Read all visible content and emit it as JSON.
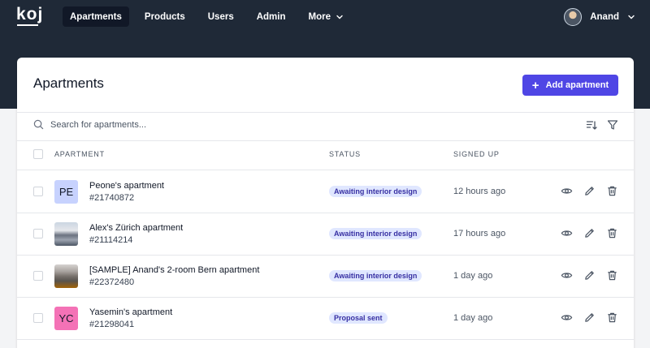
{
  "header": {
    "logo": "koj",
    "nav": [
      {
        "label": "Apartments"
      },
      {
        "label": "Products"
      },
      {
        "label": "Users"
      },
      {
        "label": "Admin"
      },
      {
        "label": "More"
      }
    ],
    "user_name": "Anand"
  },
  "page": {
    "title": "Apartments",
    "add_button": "Add apartment",
    "search_placeholder": "Search for apartments..."
  },
  "table": {
    "columns": [
      "APARTMENT",
      "STATUS",
      "SIGNED UP"
    ],
    "rows": [
      {
        "name": "Peone's apartment",
        "id": "#21740872",
        "status": "Awaiting interior design",
        "signed_up": "12 hours ago",
        "thumb_text": "PE",
        "thumb_color": "#c7d2fe"
      },
      {
        "name": "Alex's Zürich apartment",
        "id": "#21114214",
        "status": "Awaiting interior design",
        "signed_up": "17 hours ago",
        "thumb_text": "",
        "thumb_color": ""
      },
      {
        "name": "[SAMPLE] Anand's 2-room Bern apartment",
        "id": "#22372480",
        "status": "Awaiting interior design",
        "signed_up": "1 day ago",
        "thumb_text": "",
        "thumb_color": ""
      },
      {
        "name": "Yasemin's apartment",
        "id": "#21298041",
        "status": "Proposal sent",
        "signed_up": "1 day ago",
        "thumb_text": "YC",
        "thumb_color": "#f472b6"
      }
    ]
  },
  "colors": {
    "header_bg": "#1f2937",
    "accent": "#4f46e5",
    "badge_bg": "#e0e7ff",
    "badge_text": "#3730a3"
  },
  "icons": [
    "search-icon",
    "sort-icon",
    "filter-icon",
    "view-icon",
    "edit-icon",
    "delete-icon",
    "chevron-down-icon",
    "plus-icon"
  ]
}
